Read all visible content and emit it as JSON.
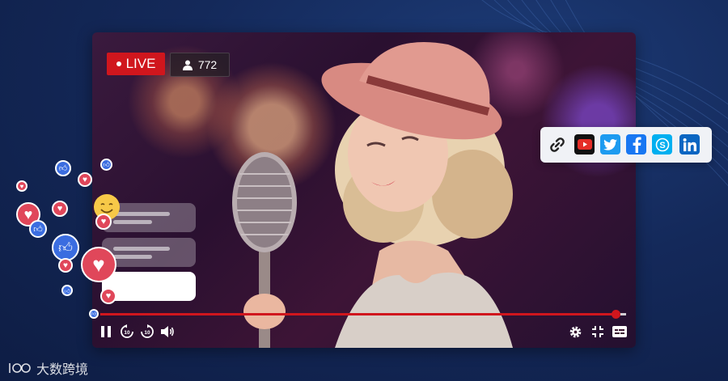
{
  "live_badge": {
    "label": "LIVE"
  },
  "viewers": {
    "count": "772"
  },
  "progress": {
    "fraction": 0.98
  },
  "controls": {
    "pause": "pause-icon",
    "rewind": "rewind-10-icon",
    "forward": "forward-10-icon",
    "volume": "volume-icon",
    "settings": "gear-icon",
    "exit_fullscreen": "exit-fullscreen-icon",
    "captions": "captions-icon"
  },
  "share": {
    "items": [
      "link-icon",
      "youtube-icon",
      "twitter-icon",
      "facebook-icon",
      "skype-icon",
      "linkedin-icon"
    ]
  },
  "colors": {
    "accent": "#d0161d",
    "youtube": "#e52d27",
    "twitter": "#1d9bf0",
    "facebook": "#1877f2",
    "skype": "#00aff0",
    "linkedin": "#0a66c2"
  },
  "watermark": {
    "text": "大数跨境"
  }
}
